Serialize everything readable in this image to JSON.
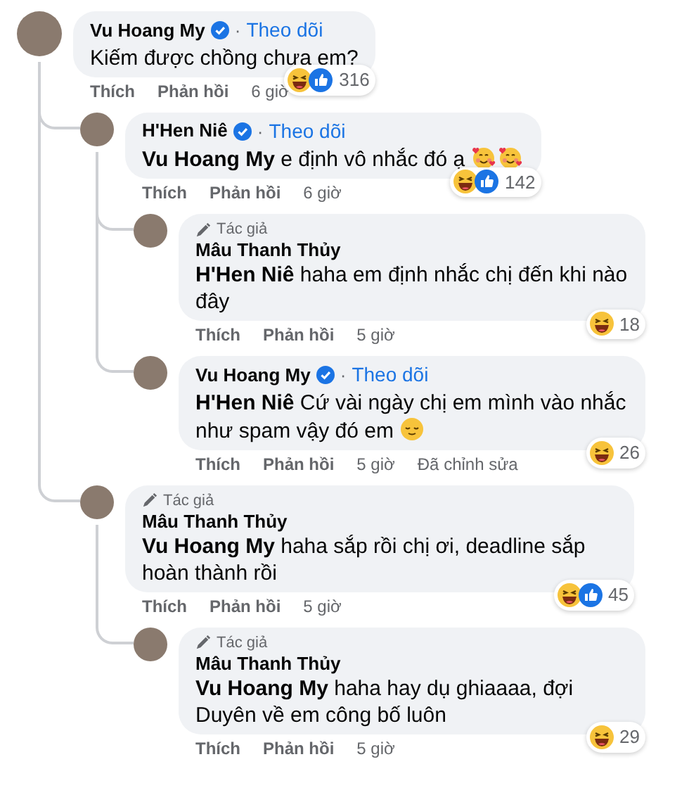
{
  "comments": [
    {
      "author": "Vu Hoang My",
      "verified": true,
      "follow_separator": "·",
      "follow": "Theo dõi",
      "text": "Kiếm được chồng chưa em?",
      "reactions": {
        "kinds": [
          {
            "kind": "haha"
          },
          {
            "kind": "like"
          }
        ],
        "count": "316"
      },
      "actions": [
        "Thích",
        "Phản hồi"
      ],
      "time": "6 giờ",
      "children": [
        {
          "author": "H'Hen Niê",
          "verified": true,
          "follow_separator": "·",
          "follow": "Theo dõi",
          "mention": "Vu Hoang My",
          "text": "e định vô nhắc đó ạ",
          "emojis": [
            {
              "kind": "hearts-face"
            },
            {
              "kind": "hearts-face"
            }
          ],
          "reactions": {
            "kinds": [
              {
                "kind": "haha"
              },
              {
                "kind": "like"
              }
            ],
            "count": "142"
          },
          "actions": [
            "Thích",
            "Phản hồi"
          ],
          "time": "6 giờ",
          "children": [
            {
              "author_badge": "Tác giả",
              "author": "Mâu Thanh Thủy",
              "verified": false,
              "mention": "H'Hen Niê",
              "text": "haha em định nhắc chị đến khi nào đây",
              "reactions": {
                "kinds": [
                  {
                    "kind": "haha"
                  }
                ],
                "count": "18"
              },
              "actions": [
                "Thích",
                "Phản hồi"
              ],
              "time": "5 giờ"
            },
            {
              "author": "Vu Hoang My",
              "verified": true,
              "follow_separator": "·",
              "follow": "Theo dõi",
              "mention": "H'Hen Niê",
              "text": "Cứ vài ngày chị em mình vào nhắc như spam vậy đó em",
              "emojis": [
                {
                  "kind": "relieved-face"
                }
              ],
              "reactions": {
                "kinds": [
                  {
                    "kind": "haha"
                  }
                ],
                "count": "26"
              },
              "actions": [
                "Thích",
                "Phản hồi"
              ],
              "time": "5 giờ",
              "edited": "Đã chỉnh sửa"
            }
          ]
        },
        {
          "author_badge": "Tác giả",
          "author": "Mâu Thanh Thủy",
          "verified": false,
          "mention": "Vu Hoang My",
          "text": "haha sắp rồi chị ơi, deadline sắp hoàn thành rồi",
          "reactions": {
            "kinds": [
              {
                "kind": "haha"
              },
              {
                "kind": "like"
              }
            ],
            "count": "45"
          },
          "actions": [
            "Thích",
            "Phản hồi"
          ],
          "time": "5 giờ",
          "children": [
            {
              "author_badge": "Tác giả",
              "author": "Mâu Thanh Thủy",
              "verified": false,
              "mention": "Vu Hoang My",
              "text": "haha hay dụ ghiaaaa, đợi Duyên về em công bố luôn",
              "reactions": {
                "kinds": [
                  {
                    "kind": "haha"
                  }
                ],
                "count": "29"
              },
              "actions": [
                "Thích",
                "Phản hồi"
              ],
              "time": "5 giờ"
            }
          ]
        }
      ]
    }
  ]
}
